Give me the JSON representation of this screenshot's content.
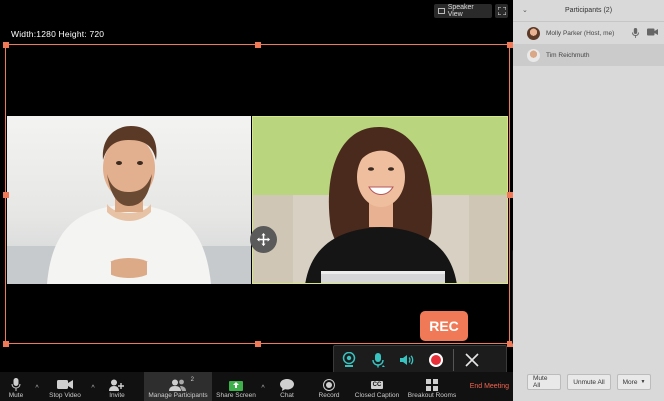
{
  "stage": {
    "speaker_view_label": "Speaker View",
    "dimensions_label": "Width:1280 Height: 720",
    "rec_label": "REC"
  },
  "controls": {
    "mute": "Mute",
    "stop_video": "Stop Video",
    "invite": "Invite",
    "manage_participants": "Manage Participants",
    "participant_count": "2",
    "share_screen": "Share Screen",
    "chat": "Chat",
    "record": "Record",
    "closed_caption": "Closed Caption",
    "cc_glyph": "CC",
    "breakout_rooms": "Breakout Rooms",
    "end_meeting": "End Meeting"
  },
  "participants_panel": {
    "title": "Participants (2)",
    "participants": [
      {
        "name": "Molly Parker (Host, me)"
      },
      {
        "name": "Tim Reichmuth"
      }
    ],
    "mute_all": "Mute All",
    "unmute_all": "Unmute All",
    "more": "More"
  },
  "colors": {
    "accent": "#f07a57",
    "end_meeting": "#f0654f",
    "rec_tool": "#39c3c0",
    "rec_dot": "#e8303a"
  },
  "icons": {
    "rec_toolbar": [
      "webcam-icon",
      "microphone-icon",
      "speaker-icon",
      "record-dot-icon",
      "close-icon"
    ],
    "side_tools": [
      "keyboard-icon",
      "cursor-highlight-icon",
      "click-effect-icon"
    ]
  }
}
